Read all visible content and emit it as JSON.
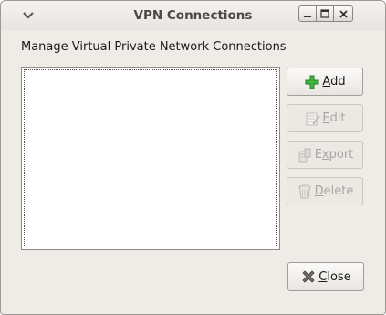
{
  "window": {
    "title": "VPN Connections"
  },
  "heading": "Manage Virtual Private Network Connections",
  "connections": [],
  "buttons": {
    "add": {
      "label": "Add",
      "accel": "A",
      "rest": "dd",
      "enabled": true,
      "icon": "plus-icon"
    },
    "edit": {
      "label": "Edit",
      "accel": "E",
      "rest": "dit",
      "enabled": false,
      "icon": "edit-icon"
    },
    "export": {
      "label": "Export",
      "accel": "x",
      "pre": "E",
      "rest": "port",
      "enabled": false,
      "icon": "export-icon"
    },
    "delete": {
      "label": "Delete",
      "accel": "D",
      "rest": "elete",
      "enabled": false,
      "icon": "trash-icon"
    },
    "close": {
      "label": "Close",
      "accel": "C",
      "rest": "lose",
      "enabled": true,
      "icon": "close-x-icon"
    }
  },
  "colors": {
    "window_bg": "#efebe7",
    "add_icon_green": "#3fb63f",
    "disabled_text": "#a9a6a1"
  }
}
